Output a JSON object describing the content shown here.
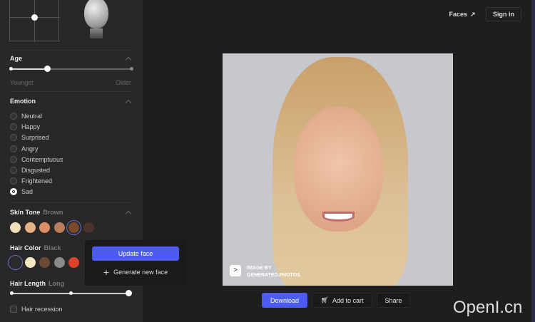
{
  "sidebar": {
    "age": {
      "title": "Age",
      "min_label": "Younger",
      "max_label": "Older",
      "value": 0.3
    },
    "emotion": {
      "title": "Emotion",
      "options": [
        "Neutral",
        "Happy",
        "Surprised",
        "Angry",
        "Contemptuous",
        "Disgusted",
        "Frightened",
        "Sad"
      ],
      "selected": "Sad"
    },
    "skin_tone": {
      "title": "Skin Tone",
      "value": "Brown",
      "swatches": [
        "#f3dfbd",
        "#e6b184",
        "#db8f66",
        "#b87d5c",
        "#7c4a2a",
        "#4a332c"
      ],
      "selected_index": 4
    },
    "hair_color": {
      "title": "Hair Color",
      "value": "Black",
      "swatches": [
        "#2b2b2b",
        "#f5e6c3",
        "#6b4a35",
        "#8a8a8a",
        "#e0412a"
      ],
      "selected_index": 0
    },
    "hair_length": {
      "title": "Hair Length",
      "value": "Long",
      "level": 1.0
    },
    "hair_recession": {
      "label": "Hair recession",
      "checked": false
    }
  },
  "popup": {
    "update_label": "Update face",
    "generate_label": "Generate new face"
  },
  "header": {
    "faces_label": "Faces",
    "signin_label": "Sign in"
  },
  "photo": {
    "watermark_line1": "IMAGE BY",
    "watermark_line2": "GENERATED.PHOTOS"
  },
  "actions": {
    "download": "Download",
    "add_to_cart": "Add to cart",
    "share": "Share"
  },
  "watermark": "OpenI.cn",
  "colors": {
    "accent": "#4d5bf5"
  }
}
